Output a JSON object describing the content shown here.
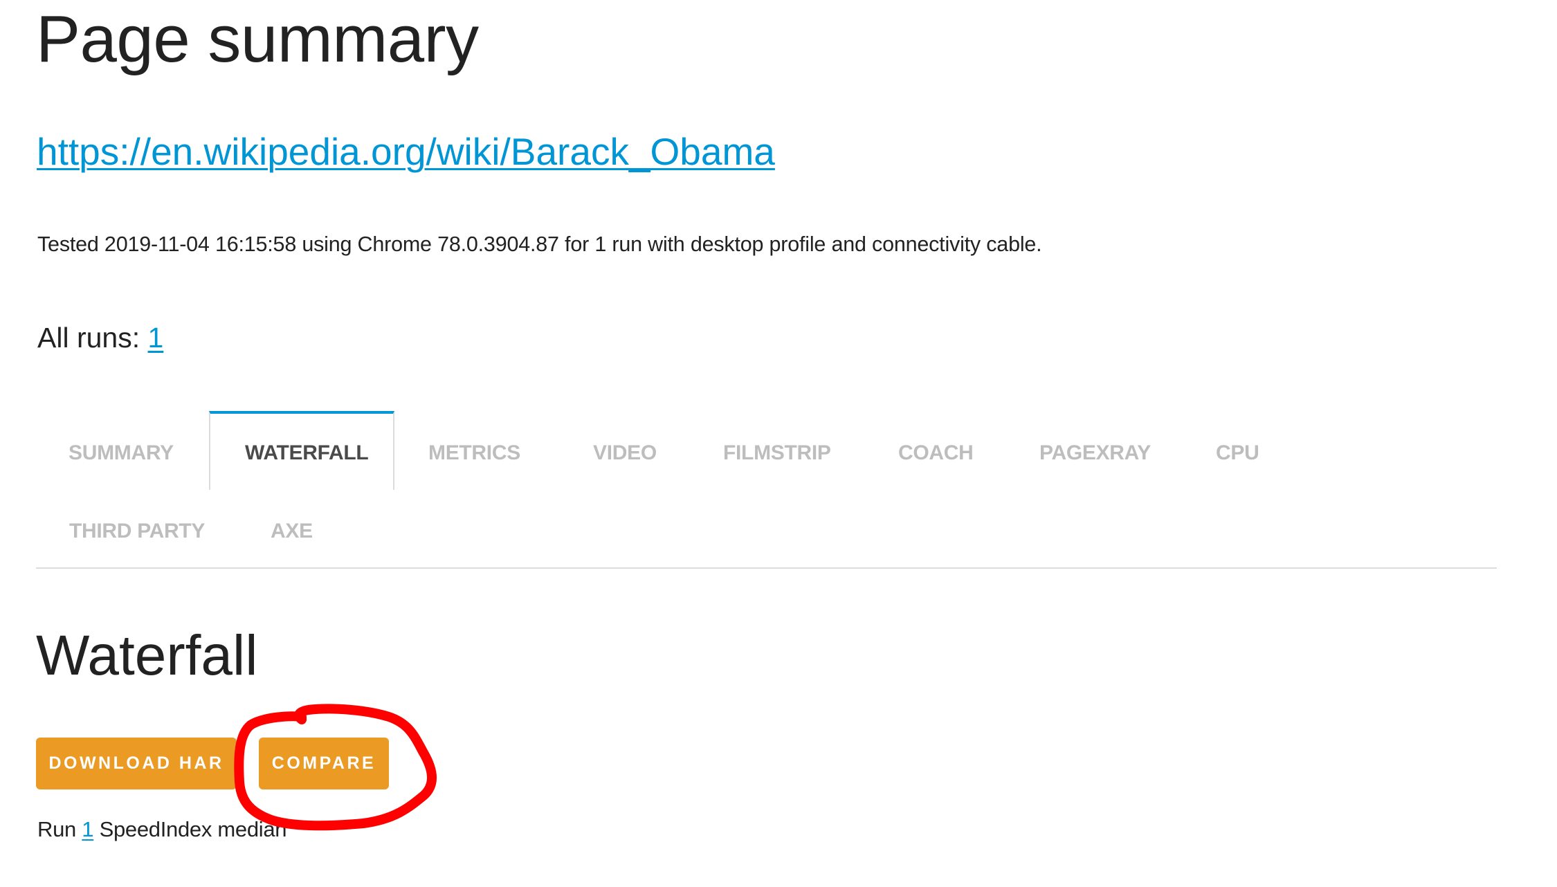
{
  "page": {
    "title": "Page summary",
    "url_link": "https://en.wikipedia.org/wiki/Barack_Obama",
    "tested_text": "Tested 2019-11-04 16:15:58 using Chrome 78.0.3904.87 for 1 run with desktop profile and connectivity cable.",
    "all_runs_label": "All runs:",
    "all_runs_links": [
      "1"
    ]
  },
  "tabs": {
    "active": "WATERFALL",
    "items": [
      {
        "label": "SUMMARY"
      },
      {
        "label": "WATERFALL"
      },
      {
        "label": "METRICS"
      },
      {
        "label": "VIDEO"
      },
      {
        "label": "FILMSTRIP"
      },
      {
        "label": "COACH"
      },
      {
        "label": "PAGEXRAY"
      },
      {
        "label": "CPU"
      },
      {
        "label": "THIRD PARTY"
      },
      {
        "label": "AXE"
      }
    ]
  },
  "section": {
    "heading": "Waterfall",
    "buttons": {
      "download_har": "DOWNLOAD HAR",
      "compare": "COMPARE"
    },
    "run_prefix": "Run",
    "run_link": "1",
    "run_suffix": "SpeedIndex median"
  },
  "annotation": {
    "type": "hand-drawn circle",
    "target": "compare-button",
    "color": "#ff0000"
  },
  "colors": {
    "link": "#0095d5",
    "active_tab_accent": "#0096d8",
    "button": "#eb9a24",
    "inactive_tab_text": "#bdbdbd",
    "active_tab_text": "#4a4a4a",
    "text": "#222222"
  }
}
